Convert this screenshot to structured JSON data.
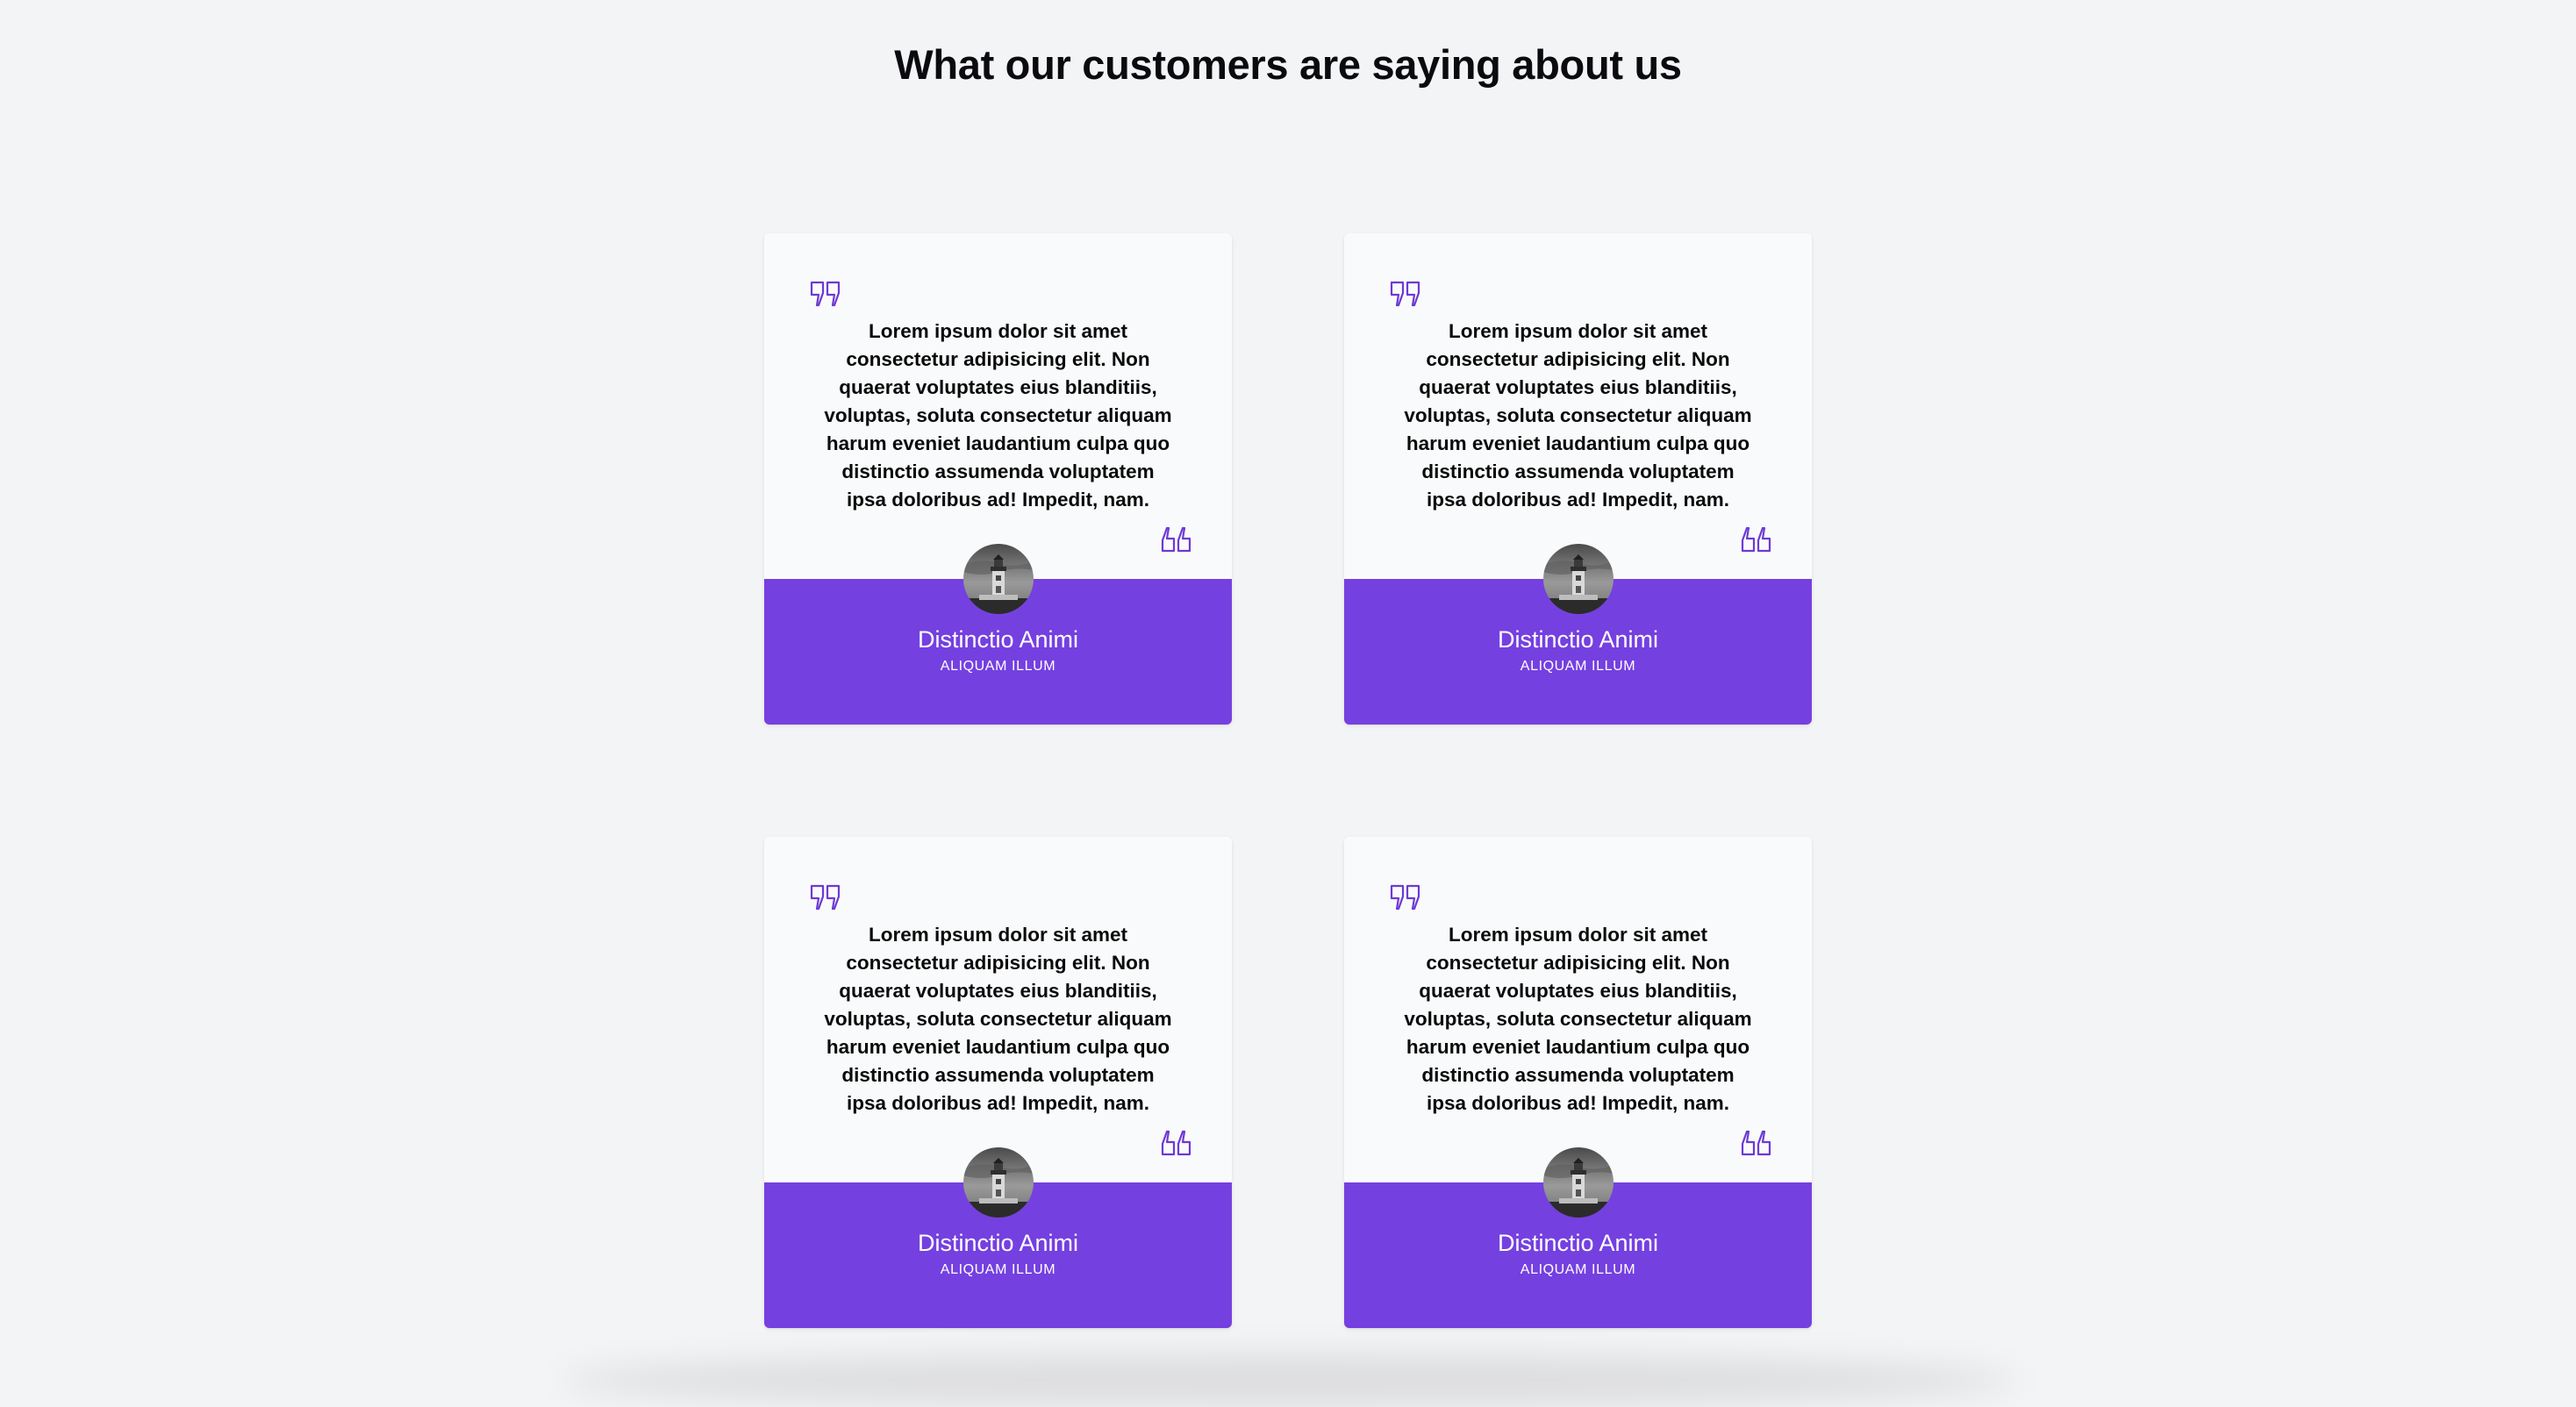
{
  "page": {
    "title": "What our customers are saying about us"
  },
  "colors": {
    "background": "#f3f4f6",
    "card": "#f9fafb",
    "accent": "#7540e0",
    "quote_icon": "#6d3ad4"
  },
  "testimonials": [
    {
      "quote": "Lorem ipsum dolor sit amet consectetur adipisicing elit. Non quaerat voluptates eius blanditiis, voluptas, soluta consectetur aliquam harum eveniet laudantium culpa quo distinctio assumenda voluptatem ipsa doloribus ad! Impedit, nam.",
      "name": "Distinctio Animi",
      "role": "ALIQUAM ILLUM",
      "avatar_icon": "lighthouse-photo"
    },
    {
      "quote": "Lorem ipsum dolor sit amet consectetur adipisicing elit. Non quaerat voluptates eius blanditiis, voluptas, soluta consectetur aliquam harum eveniet laudantium culpa quo distinctio assumenda voluptatem ipsa doloribus ad! Impedit, nam.",
      "name": "Distinctio Animi",
      "role": "ALIQUAM ILLUM",
      "avatar_icon": "lighthouse-photo"
    },
    {
      "quote": "Lorem ipsum dolor sit amet consectetur adipisicing elit. Non quaerat voluptates eius blanditiis, voluptas, soluta consectetur aliquam harum eveniet laudantium culpa quo distinctio assumenda voluptatem ipsa doloribus ad! Impedit, nam.",
      "name": "Distinctio Animi",
      "role": "ALIQUAM ILLUM",
      "avatar_icon": "lighthouse-photo"
    },
    {
      "quote": "Lorem ipsum dolor sit amet consectetur adipisicing elit. Non quaerat voluptates eius blanditiis, voluptas, soluta consectetur aliquam harum eveniet laudantium culpa quo distinctio assumenda voluptatem ipsa doloribus ad! Impedit, nam.",
      "name": "Distinctio Animi",
      "role": "ALIQUAM ILLUM",
      "avatar_icon": "lighthouse-photo"
    }
  ]
}
